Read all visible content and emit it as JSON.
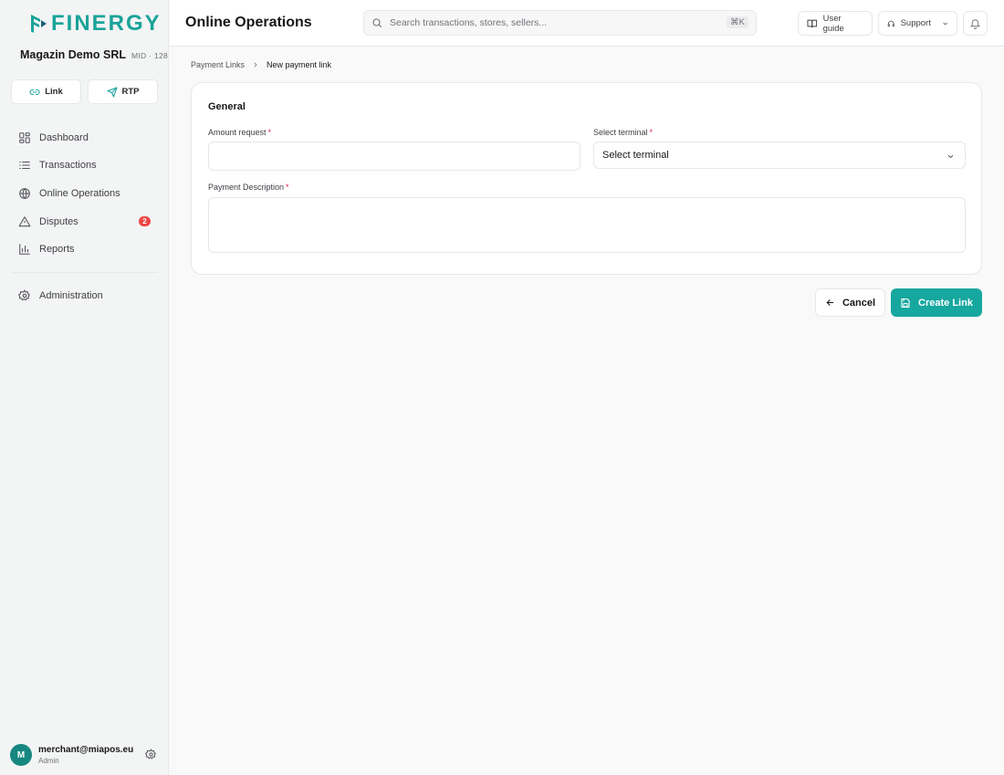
{
  "brand": {
    "name": "FINERGY",
    "accent": "#16a79e",
    "badge_red": "#ef4444"
  },
  "merchant": {
    "name": "Magazin Demo SRL",
    "mid": "MID · 128"
  },
  "quick_actions": [
    {
      "label": "Link",
      "icon": "link-icon"
    },
    {
      "label": "RTP",
      "icon": "send-icon"
    }
  ],
  "nav": {
    "items": [
      {
        "label": "Dashboard",
        "icon": "dashboard-icon"
      },
      {
        "label": "Transactions",
        "icon": "list-icon"
      },
      {
        "label": "Online Operations",
        "icon": "globe-icon"
      },
      {
        "label": "Disputes",
        "icon": "warning-icon",
        "badge": "2"
      },
      {
        "label": "Reports",
        "icon": "bar-chart-icon"
      },
      {
        "label": "Administration",
        "icon": "gear-icon"
      }
    ]
  },
  "user": {
    "initial": "M",
    "email": "merchant@miapos.eu",
    "role": "Admin"
  },
  "header": {
    "title": "Online Operations",
    "search_placeholder": "Search transactions, stores, sellers...",
    "shortcut": "⌘K",
    "user_guide": "User guide",
    "support": "Support"
  },
  "breadcrumb": {
    "parent": "Payment Links",
    "current": "New payment link"
  },
  "form": {
    "section_title": "General",
    "amount_label": "Amount request",
    "amount_value": "",
    "terminal_label": "Select terminal",
    "terminal_value": "Select terminal",
    "description_label": "Payment Description",
    "description_value": "",
    "required_mark": "*"
  },
  "actions": {
    "cancel": "Cancel",
    "create": "Create Link"
  }
}
